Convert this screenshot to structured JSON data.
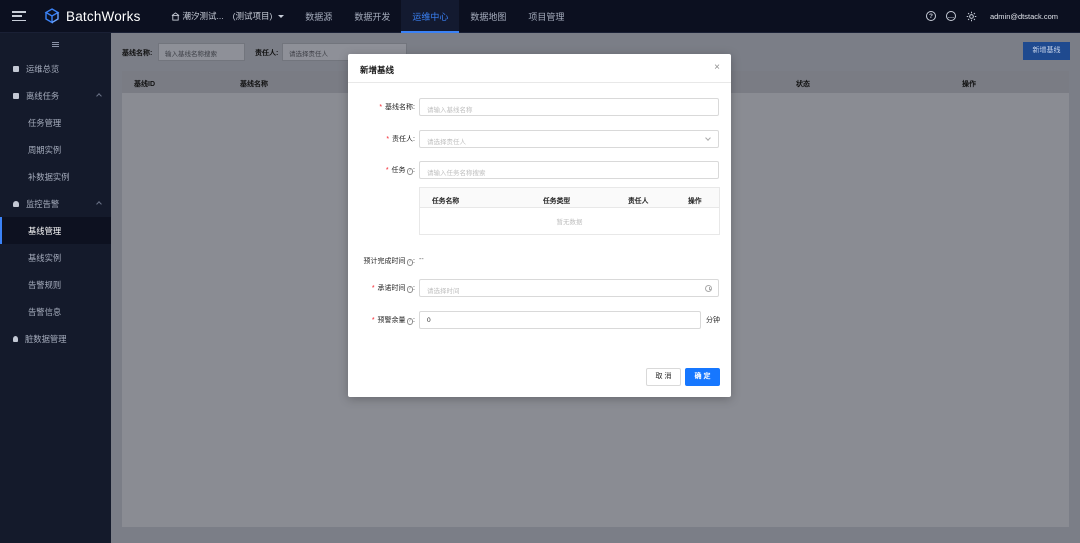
{
  "app": {
    "brand": "BatchWorks",
    "project": "潮汐测试...",
    "project_tag": "(测试项目)"
  },
  "nav": [
    {
      "label": "数据源"
    },
    {
      "label": "数据开发"
    },
    {
      "label": "运维中心",
      "active": true
    },
    {
      "label": "数据地图"
    },
    {
      "label": "项目管理"
    }
  ],
  "user": {
    "email": "admin@dtstack.com"
  },
  "sidebar": {
    "items": [
      {
        "label": "运维总览"
      },
      {
        "label": "离线任务"
      },
      {
        "label": "任务管理"
      },
      {
        "label": "周期实例"
      },
      {
        "label": "补数据实例"
      },
      {
        "label": "监控告警"
      },
      {
        "label": "基线管理"
      },
      {
        "label": "基线实例"
      },
      {
        "label": "告警规则"
      },
      {
        "label": "告警信息"
      },
      {
        "label": "脏数据管理"
      }
    ]
  },
  "filter": {
    "name_label": "基线名称:",
    "name_placeholder": "输入基线名称搜索",
    "owner_label": "责任人:",
    "owner_placeholder": "请选择责任人",
    "new_button": "新增基线"
  },
  "table": {
    "columns": [
      "基线ID",
      "基线名称",
      "状态",
      "操作"
    ]
  },
  "modal": {
    "title": "新增基线",
    "close": "×",
    "fields": {
      "name": {
        "label": "基线名称:",
        "placeholder": "请输入基线名称"
      },
      "owner": {
        "label": "责任人:",
        "placeholder": "请选择责任人"
      },
      "task": {
        "label": "任务",
        "placeholder": "请输入任务名称搜索"
      },
      "estimate": {
        "label": "预计完成时间",
        "value": "--"
      },
      "commit": {
        "label": "承诺时间",
        "placeholder": "请选择时间"
      },
      "margin": {
        "label": "预警余量",
        "value": "0",
        "unit": "分钟"
      }
    },
    "inner_table": {
      "columns": [
        "任务名称",
        "任务类型",
        "责任人",
        "操作"
      ],
      "empty": "暂无数据"
    },
    "buttons": {
      "cancel": "取 消",
      "ok": "确 定"
    }
  },
  "colors": {
    "accent": "#3b82f6",
    "primary_button": "#1677ff",
    "required": "#f5222d",
    "topbar": "#0c1020",
    "sidebar": "#141a2b"
  }
}
